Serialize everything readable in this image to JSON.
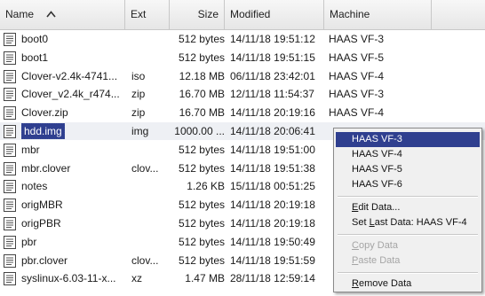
{
  "columns": {
    "name": "Name",
    "ext": "Ext",
    "size": "Size",
    "modified": "Modified",
    "machine": "Machine"
  },
  "files": [
    {
      "name": "boot0",
      "ext": "",
      "size": "512 bytes",
      "modified": "14/11/18 19:51:12",
      "machine": "HAAS VF-3"
    },
    {
      "name": "boot1",
      "ext": "",
      "size": "512 bytes",
      "modified": "14/11/18 19:51:15",
      "machine": "HAAS VF-5"
    },
    {
      "name": "Clover-v2.4k-4741...",
      "ext": "iso",
      "size": "12.18 MB",
      "modified": "06/11/18 23:42:01",
      "machine": "HAAS VF-4"
    },
    {
      "name": "Clover_v2.4k_r474...",
      "ext": "zip",
      "size": "16.70 MB",
      "modified": "12/11/18 11:54:37",
      "machine": "HAAS VF-3"
    },
    {
      "name": "Clover.zip",
      "ext": "zip",
      "size": "16.70 MB",
      "modified": "14/11/18 20:19:16",
      "machine": "HAAS VF-4"
    },
    {
      "name": "hdd.img",
      "ext": "img",
      "size": "1000.00 ...",
      "modified": "14/11/18 20:06:41",
      "machine": ""
    },
    {
      "name": "mbr",
      "ext": "",
      "size": "512 bytes",
      "modified": "14/11/18 19:51:00",
      "machine": ""
    },
    {
      "name": "mbr.clover",
      "ext": "clov...",
      "size": "512 bytes",
      "modified": "14/11/18 19:51:38",
      "machine": ""
    },
    {
      "name": "notes",
      "ext": "",
      "size": "1.26 KB",
      "modified": "15/11/18 00:51:25",
      "machine": ""
    },
    {
      "name": "origMBR",
      "ext": "",
      "size": "512 bytes",
      "modified": "14/11/18 20:19:18",
      "machine": ""
    },
    {
      "name": "origPBR",
      "ext": "",
      "size": "512 bytes",
      "modified": "14/11/18 20:19:18",
      "machine": ""
    },
    {
      "name": "pbr",
      "ext": "",
      "size": "512 bytes",
      "modified": "14/11/18 19:50:49",
      "machine": ""
    },
    {
      "name": "pbr.clover",
      "ext": "clov...",
      "size": "512 bytes",
      "modified": "14/11/18 19:51:59",
      "machine": ""
    },
    {
      "name": "syslinux-6.03-11-x...",
      "ext": "xz",
      "size": "1.47 MB",
      "modified": "28/11/18 12:59:14",
      "machine": ""
    }
  ],
  "selected_file": "hdd.img",
  "context_menu": {
    "machines": [
      "HAAS VF-3",
      "HAAS VF-4",
      "HAAS VF-5",
      "HAAS VF-6"
    ],
    "active_machine": "HAAS VF-3",
    "edit_data": {
      "pre": "",
      "u": "E",
      "post": "dit Data..."
    },
    "set_last_data": {
      "pre": "Set ",
      "u": "L",
      "post": "ast Data: HAAS VF-4"
    },
    "copy_data": {
      "pre": "",
      "u": "C",
      "post": "opy Data"
    },
    "paste_data": {
      "pre": "",
      "u": "P",
      "post": "aste Data"
    },
    "remove_data": {
      "pre": "",
      "u": "R",
      "post": "emove Data"
    }
  },
  "icons": {
    "file": "document-icon",
    "sort": "sort-ascending-icon"
  },
  "colors": {
    "selection": "#2f3f8f",
    "menu_bg": "#f0f0f0",
    "disabled_text": "#a5a5a5"
  }
}
